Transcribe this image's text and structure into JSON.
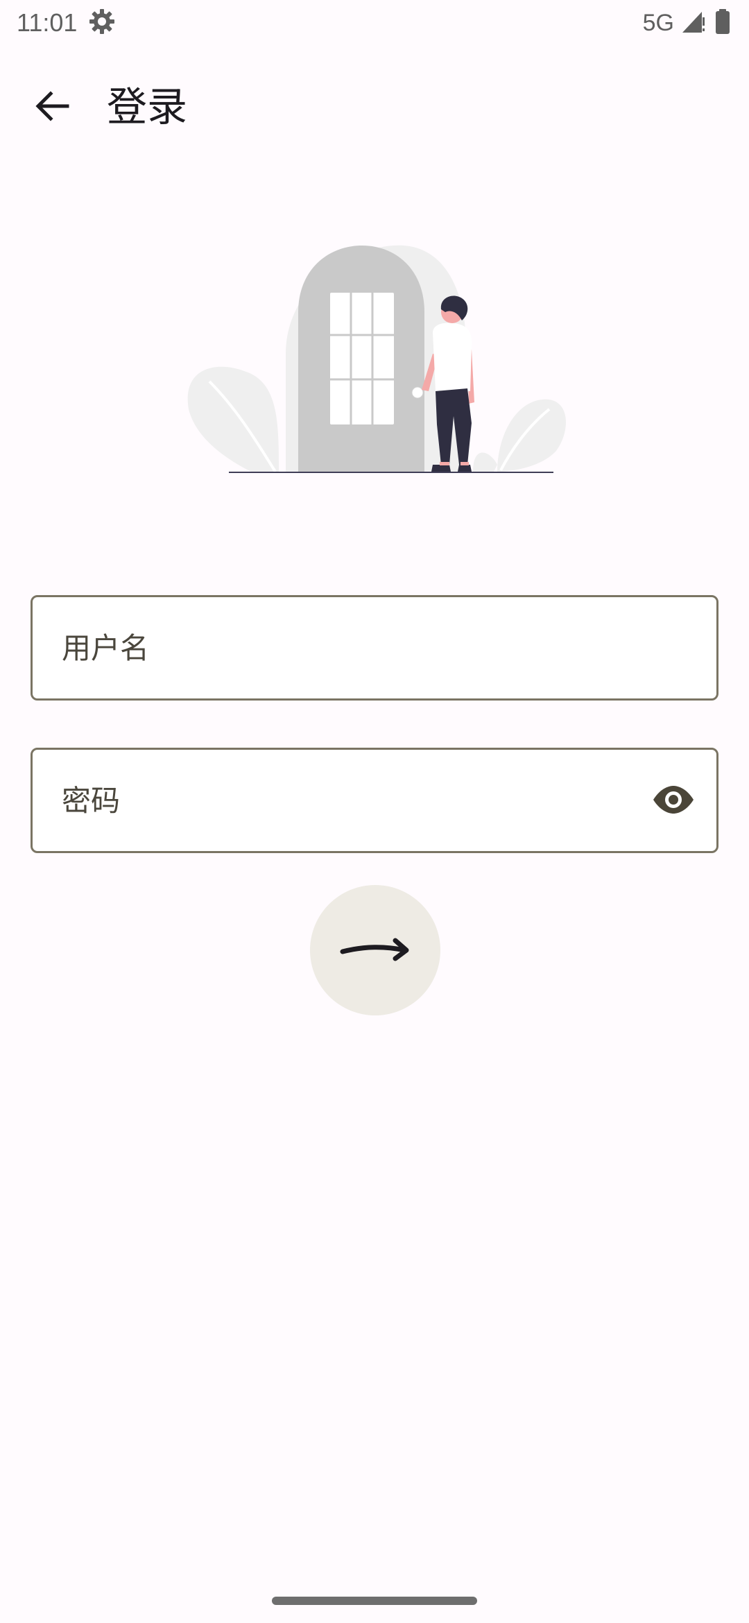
{
  "status_bar": {
    "time": "11:01",
    "settings_icon": "gear-icon",
    "network": "5G",
    "signal_icon": "signal-icon",
    "battery_icon": "battery-icon"
  },
  "app_bar": {
    "back_icon": "arrow-back-icon",
    "title": "登录"
  },
  "illustration": {
    "name": "person-at-door-illustration"
  },
  "form": {
    "username_placeholder": "用户名",
    "username_value": "",
    "password_placeholder": "密码",
    "password_value": "",
    "password_toggle_icon": "eye-icon",
    "submit_icon": "arrow-right-icon"
  },
  "colors": {
    "background": "#fffbfe",
    "field_border": "#7a7463",
    "submit_bg": "#eeebe4",
    "door": "#c9c9c9",
    "foliage": "#efefef"
  }
}
